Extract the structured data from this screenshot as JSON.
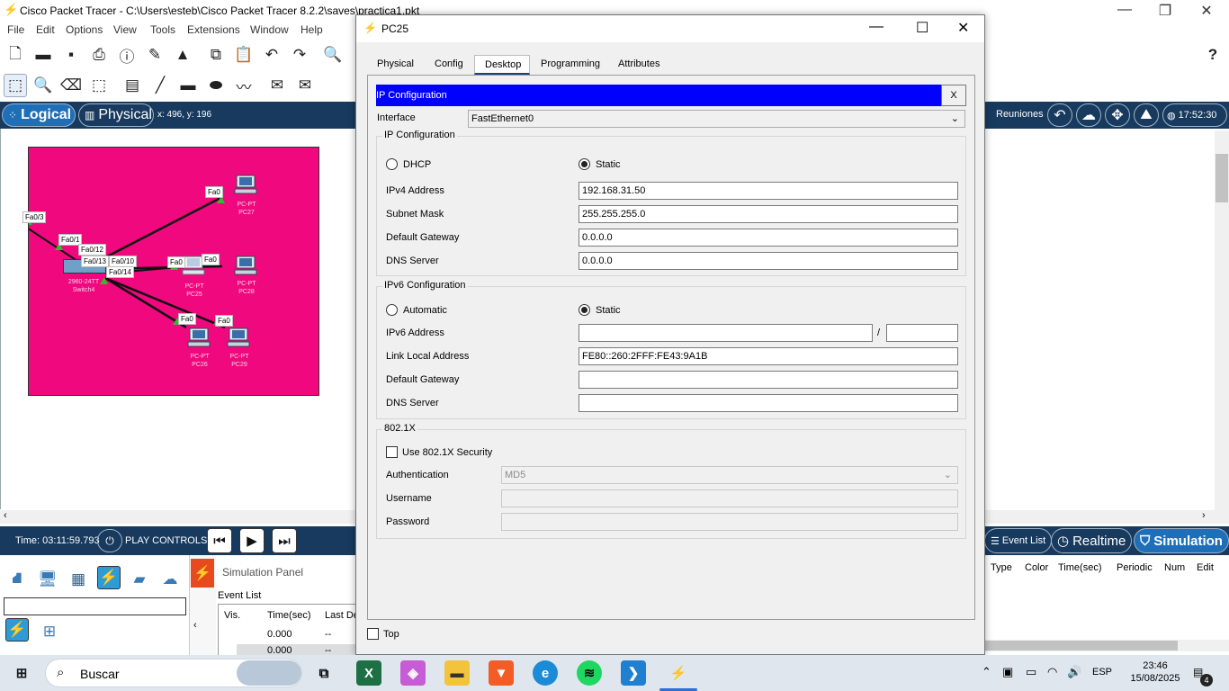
{
  "app": {
    "title": "Cisco Packet Tracer - C:\\Users\\esteb\\Cisco Packet Tracer 8.2.2\\saves\\practica1.pkt",
    "help_glyph": "?"
  },
  "menu": [
    "File",
    "Edit",
    "Options",
    "View",
    "Tools",
    "Extensions",
    "Window",
    "Help"
  ],
  "modebar": {
    "logical": "Logical",
    "physical": "Physical",
    "coords": "x: 496, y: 196",
    "reuniones": "Reuniones",
    "clock": "17:52:30"
  },
  "network": {
    "labels": [
      "Fa0/3",
      "Fa0/1",
      "Fa0/12",
      "Fa0/13",
      "Fa0/10",
      "Fa0/14",
      "Fa0",
      "Fa0",
      "Fa0",
      "Fa0",
      "Fa0"
    ],
    "devices": [
      {
        "type": "PC-PT",
        "name": "PC27"
      },
      {
        "type": "PC-PT",
        "name": "PC25"
      },
      {
        "type": "PC-PT",
        "name": "PC26"
      },
      {
        "type": "PC-PT",
        "name": "PC28"
      },
      {
        "type": "PC-PT",
        "name": "PC29"
      },
      {
        "type": "2960-24TT",
        "name": "Switch4"
      }
    ]
  },
  "sim": {
    "time": "Time: 03:11:59.793",
    "play_controls": "PLAY CONTROLS:",
    "event_list_btn": "Event List",
    "realtime": "Realtime",
    "simulation": "Simulation",
    "panel_title": "Simulation Panel",
    "event_list": "Event List",
    "cols": [
      "Vis.",
      "Time(sec)",
      "Last De"
    ],
    "rows": [
      {
        "time": "0.000",
        "last": "--"
      },
      {
        "time": "0.000",
        "last": "--"
      }
    ],
    "pdu_cols": [
      "Type",
      "Color",
      "Time(sec)",
      "Periodic",
      "Num",
      "Edit"
    ]
  },
  "dialog": {
    "title": "PC25",
    "tabs": [
      "Physical",
      "Config",
      "Desktop",
      "Programming",
      "Attributes"
    ],
    "active_tab": "Desktop",
    "ipconfig_header": "IP Configuration",
    "close_x": "X",
    "interface_label": "Interface",
    "interface_value": "FastEthernet0",
    "ipv4_group": "IP Configuration",
    "dhcp": "DHCP",
    "static": "Static",
    "ipv4_label": "IPv4 Address",
    "ipv4_value": "192.168.31.50",
    "mask_label": "Subnet Mask",
    "mask_value": "255.255.255.0",
    "gw_label": "Default Gateway",
    "gw_value": "0.0.0.0",
    "dns_label": "DNS Server",
    "dns_value": "0.0.0.0",
    "ipv6_group": "IPv6 Configuration",
    "automatic": "Automatic",
    "static6": "Static",
    "ipv6_label": "IPv6 Address",
    "ipv6_value": "",
    "slash": "/",
    "prefix_value": "",
    "link_local_label": "Link Local Address",
    "link_local_value": "FE80::260:2FFF:FE43:9A1B",
    "gw6_label": "Default Gateway",
    "gw6_value": "",
    "dns6_label": "DNS Server",
    "dns6_value": "",
    "dot1x_group": "802.1X",
    "use_8021x": "Use 802.1X Security",
    "auth_label": "Authentication",
    "auth_value": "MD5",
    "username_label": "Username",
    "username_value": "",
    "password_label": "Password",
    "password_value": "",
    "top_label": "Top"
  },
  "taskbar": {
    "search": "Buscar",
    "lang": "ESP",
    "time": "23:46",
    "date": "15/08/2025",
    "notif": "4"
  },
  "colors": {
    "modebar": "#173a5e",
    "canvas_area": "#f0087e",
    "ipconfig_header": "#0000ff"
  }
}
